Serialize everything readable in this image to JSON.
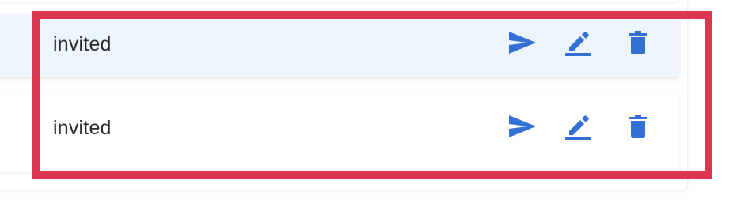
{
  "rows": [
    {
      "status": "invited",
      "actions": [
        "send-icon",
        "edit-icon",
        "delete-icon"
      ],
      "hovered": true
    },
    {
      "status": "invited",
      "actions": [
        "send-icon",
        "edit-icon",
        "delete-icon"
      ],
      "hovered": false
    }
  ],
  "colors": {
    "icon": "#3370d6",
    "row_hover_bg": "#edf4fc",
    "highlight_border": "#dc3550",
    "text": "#2b2b2b"
  }
}
